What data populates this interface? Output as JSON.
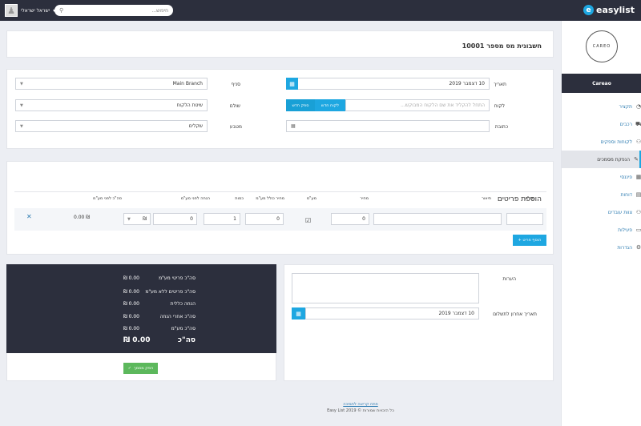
{
  "topbar": {
    "logo_text": "easylist",
    "logo_mark": "e",
    "user_name": "ישראל ישראלי",
    "user_caret": "▾",
    "search_placeholder": "חיפוש...",
    "search_icon": "search-icon"
  },
  "sidebar": {
    "brand_logo_text": "CAREO",
    "brand_name": "Careao",
    "items": [
      {
        "label": "תקציר",
        "icon": "gauge-icon",
        "glyph": "◔"
      },
      {
        "label": "רכבים",
        "icon": "car-icon",
        "glyph": "⛟"
      },
      {
        "label": "לקוחות וספקים",
        "icon": "users-icon",
        "glyph": "⚇"
      },
      {
        "label": "הנפקת מסמכים",
        "icon": "edit-icon",
        "glyph": "✎",
        "active": true
      },
      {
        "label": "פיננסי",
        "icon": "calculator-icon",
        "glyph": "▦"
      },
      {
        "label": "דוחות",
        "icon": "book-icon",
        "glyph": "▤"
      },
      {
        "label": "צוות עובדים",
        "icon": "team-icon",
        "glyph": "⚇"
      },
      {
        "label": "פעילות",
        "icon": "chat-icon",
        "glyph": "▭"
      },
      {
        "label": "הגדרות",
        "icon": "cogs-icon",
        "glyph": "⚙"
      }
    ]
  },
  "invoice": {
    "title": "חשבונית מס מספר 10001"
  },
  "form": {
    "date_label": "תאריך",
    "date_value": "10 דצמבר 2019",
    "branch_label": "סניף",
    "branch_value": "Main Branch",
    "customer_label": "לקוח",
    "customer_placeholder": "התחל להקליד את שם הלקוח המבוקש...",
    "new_customer_btn": "לקוח חדש",
    "new_supplier_btn": "ספק חדש",
    "currency_label": "מטבע",
    "currency_value": "שקלים",
    "address_label": "כתובת",
    "payment_label": "שולם",
    "payment_placeholder": "שיטת הלקוח"
  },
  "items": {
    "title": "הוספת פריטים",
    "headers": {
      "sku": "מק\"ט",
      "description": "תיאור",
      "price": "מחיר",
      "vat": "מע\"מ",
      "price_incl": "מחיר כולל מע\"מ",
      "qty": "כמות",
      "discount": "הנחה לפני מע\"מ",
      "total": "סה\"כ לפני מע\"מ"
    },
    "row": {
      "sku": "",
      "description": "",
      "price": "0",
      "vat_checked": "☑",
      "price_incl": "0",
      "qty": "1",
      "discount": "0",
      "discount_type": "₪",
      "total": "₪ 0.00",
      "remove": "✕"
    },
    "add_button": "+ הוסף פריט"
  },
  "notes": {
    "label": "הערות",
    "value": "",
    "due_label": "תאריך אחרון לתשלום",
    "due_value": "10 דצמבר 2019"
  },
  "summary": {
    "rows": [
      {
        "label": "סה\"כ פריטי מע\"מ",
        "value": "0.00 ₪"
      },
      {
        "label": "סה\"כ פריטים ללא מע\"מ",
        "value": "0.00 ₪"
      },
      {
        "label": "הנחה כללית",
        "value": "0.00 ₪"
      },
      {
        "label": "סה\"כ אחרי הנחה",
        "value": "0.00 ₪"
      },
      {
        "label": "סה\"כ מע\"מ",
        "value": "0.00 ₪"
      }
    ],
    "total_label": "סה\"כ",
    "total_value": "0.00 ₪",
    "create_button": "הפק מסמך"
  },
  "footer": {
    "link": "פתח קריאה לתמיכה",
    "copyright": "כל הזכויות שמורות © Easy List 2019"
  },
  "colors": {
    "dark": "#2c2f3d",
    "accent": "#1ea7e1",
    "success": "#5cb85c"
  }
}
